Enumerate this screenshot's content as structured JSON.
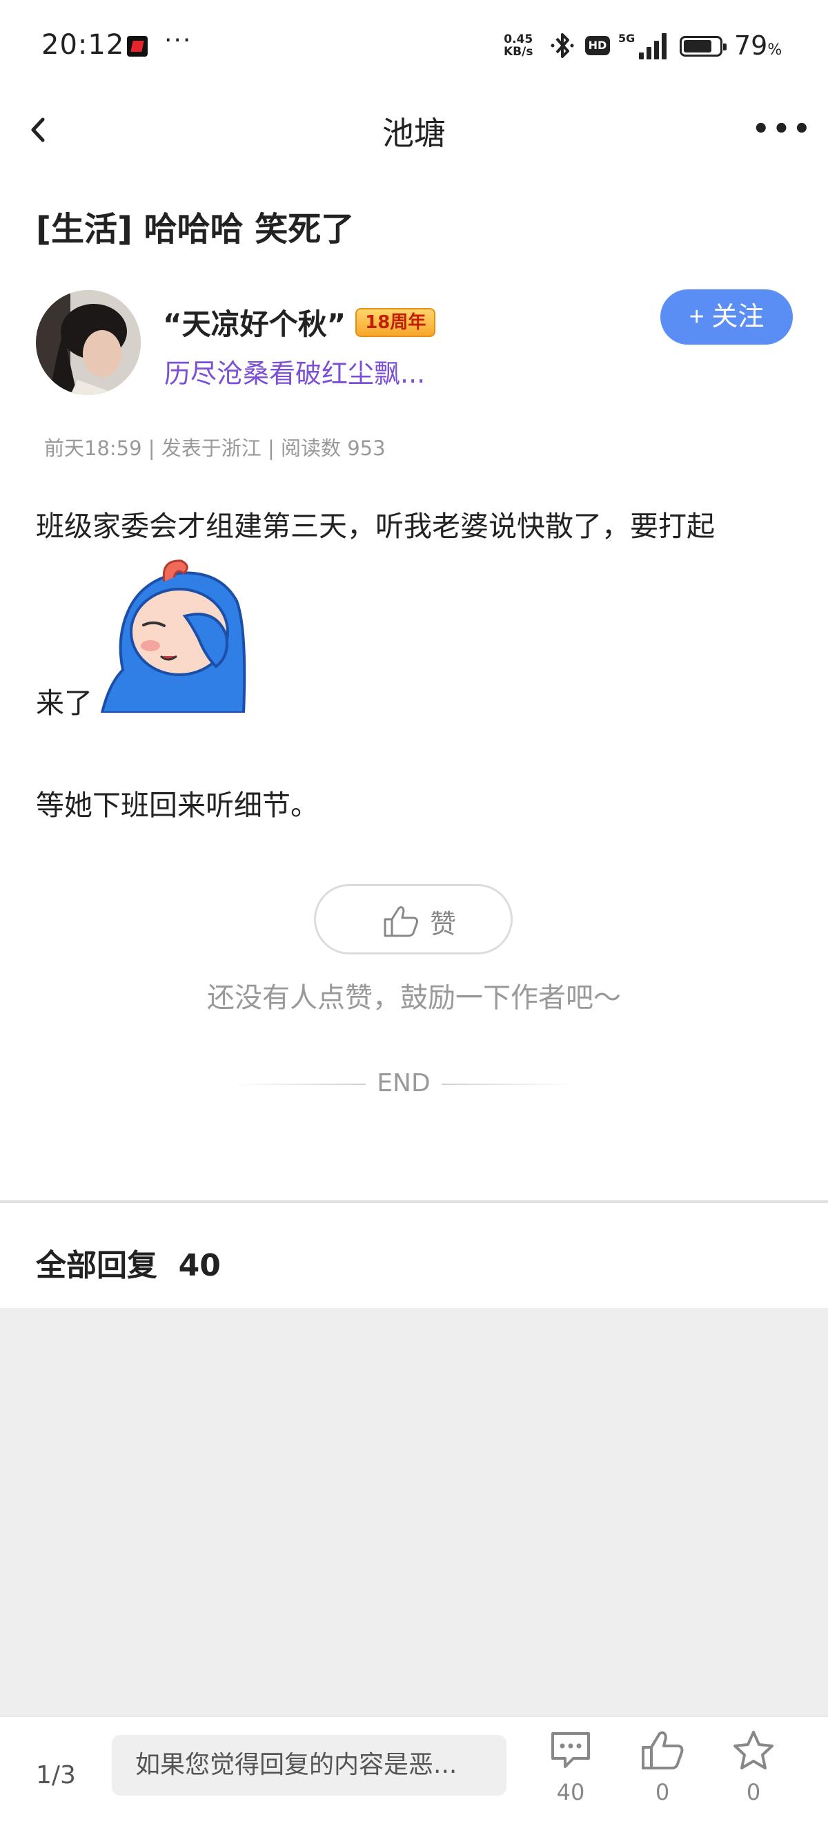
{
  "status_bar": {
    "time": "20:12",
    "dots": "···",
    "net_speed_value": "0.45",
    "net_speed_unit": "KB/s",
    "hd_label": "HD",
    "network_type": "5G",
    "battery_percent_value": "79",
    "battery_percent_sign": "%",
    "battery_level": 0.79
  },
  "nav": {
    "title": "池塘",
    "more": "•••"
  },
  "post": {
    "title": "[生活] 哈哈哈 笑死了",
    "author": {
      "name": "“天凉好个秋”",
      "badge": "18周年",
      "signature": "历尽沧桑看破红尘飘..."
    },
    "follow_label": "+ 关注",
    "meta": "前天18:59 | 发表于浙江 | 阅读数 953",
    "body_line1": "班级家委会才组建第三天，听我老婆说快散了，要打起",
    "body_line2": "来了",
    "body_line3": "等她下班回来听细节。",
    "like_label": "赞",
    "like_hint": "还没有人点赞，鼓励一下作者吧～",
    "end_label": "END"
  },
  "replies": {
    "title": "全部回复",
    "count": "40"
  },
  "bottom_bar": {
    "page_indicator": "1/3",
    "reply_placeholder": "如果您觉得回复的内容是恶...",
    "comment_count": "40",
    "like_count": "0",
    "favorite_count": "0"
  },
  "colors": {
    "follow_button": "#5b8ef5",
    "signature": "#7b4fd6",
    "badge": "#f7a72b"
  }
}
